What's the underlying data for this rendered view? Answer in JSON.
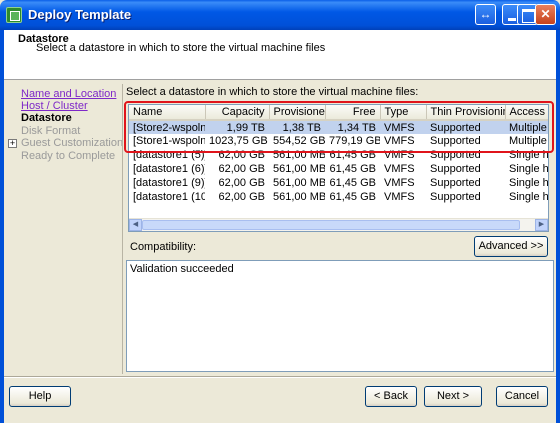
{
  "window": {
    "title": "Deploy Template"
  },
  "header": {
    "title": "Datastore",
    "subtitle": "Select a datastore in which to store the virtual machine files"
  },
  "nav": {
    "items": [
      {
        "label": "Name and Location",
        "state": "link"
      },
      {
        "label": "Host / Cluster",
        "state": "link"
      },
      {
        "label": "Datastore",
        "state": "active"
      },
      {
        "label": "Disk Format",
        "state": "disabled"
      },
      {
        "label": "Guest Customization",
        "state": "disabled",
        "expandable": true
      },
      {
        "label": "Ready to Complete",
        "state": "disabled"
      }
    ]
  },
  "main": {
    "prompt": "Select a datastore in which to store the virtual machine files:",
    "columns": [
      "Name",
      "Capacity",
      "Provisioned",
      "Free",
      "Type",
      "Thin Provisioning",
      "Access"
    ],
    "rows": [
      [
        "[Store2-wspoln...",
        "1,99 TB",
        "1,38 TB",
        "1,34 TB",
        "VMFS",
        "Supported",
        "Multiple ho"
      ],
      [
        "[Store1-wspoln...",
        "1023,75 GB",
        "554,52 GB",
        "779,19 GB",
        "VMFS",
        "Supported",
        "Multiple ho"
      ],
      [
        "[datastore1 (5)]",
        "62,00 GB",
        "561,00 MB",
        "61,45 GB",
        "VMFS",
        "Supported",
        "Single hos"
      ],
      [
        "[datastore1 (6)]",
        "62,00 GB",
        "561,00 MB",
        "61,45 GB",
        "VMFS",
        "Supported",
        "Single hos"
      ],
      [
        "[datastore1 (9)]",
        "62,00 GB",
        "561,00 MB",
        "61,45 GB",
        "VMFS",
        "Supported",
        "Single hos"
      ],
      [
        "[datastore1 (10...",
        "62,00 GB",
        "561,00 MB",
        "61,45 GB",
        "VMFS",
        "Supported",
        "Single hos"
      ]
    ],
    "selected_row": 0,
    "compatibility_label": "Compatibility:",
    "advanced_button": "Advanced >>",
    "validation_text": "Validation succeeded"
  },
  "footer": {
    "help": "Help",
    "back": "< Back",
    "next": "Next >",
    "cancel": "Cancel"
  },
  "colors": {
    "titlebar": "#0058e6",
    "highlight": "#e0141b",
    "selection": "#c1d2ee",
    "link": "#7e28c8"
  }
}
